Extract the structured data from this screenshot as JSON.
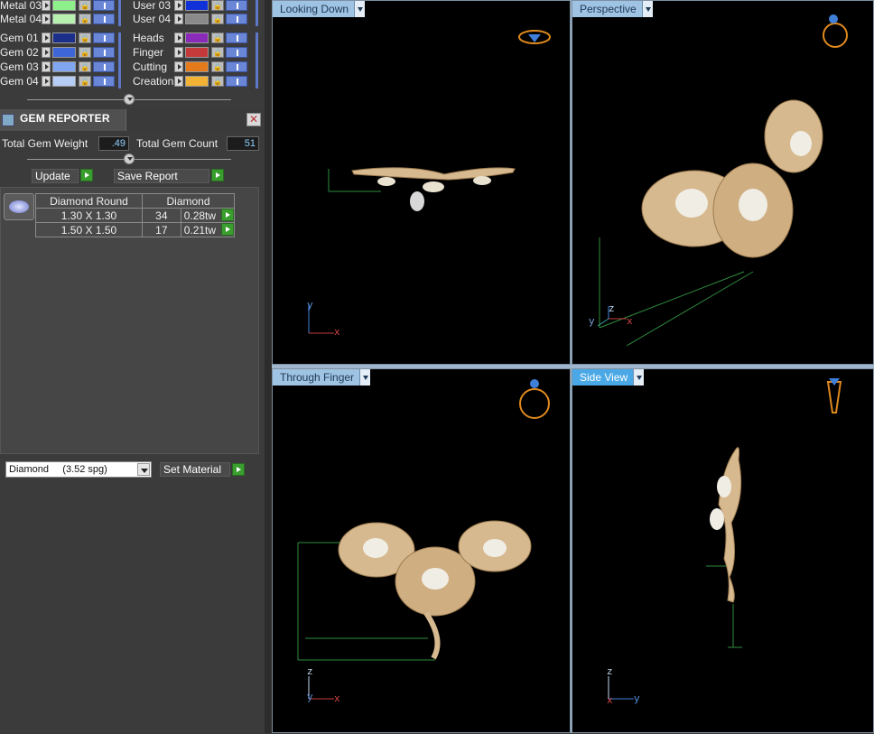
{
  "layers": {
    "left_column": [
      {
        "name": "Metal 03",
        "color": "#8ef08a"
      },
      {
        "name": "Metal 04",
        "color": "#b8f0b0"
      },
      {
        "name": "Gem 01",
        "color": "#1b2e8a"
      },
      {
        "name": "Gem 02",
        "color": "#3f66d6"
      },
      {
        "name": "Gem 03",
        "color": "#7fa6ef"
      },
      {
        "name": "Gem 04",
        "color": "#b5cdf5"
      }
    ],
    "right_column": [
      {
        "name": "User 03",
        "color": "#1030d8"
      },
      {
        "name": "User 04",
        "color": "#8a8a8a"
      },
      {
        "name": "Heads",
        "color": "#8a2ab8"
      },
      {
        "name": "Finger",
        "color": "#c43a3a"
      },
      {
        "name": "Cutting",
        "color": "#e57a1a"
      },
      {
        "name": "Creation",
        "color": "#f2b233"
      }
    ]
  },
  "gem_reporter": {
    "title": "GEM REPORTER",
    "close_label": "✕",
    "total_weight_label": "Total Gem Weight",
    "total_weight_value": ".49",
    "total_count_label": "Total Gem Count",
    "total_count_value": "51",
    "update_label": "Update",
    "save_report_label": "Save Report",
    "table": {
      "headers": [
        "Diamond Round",
        "Diamond"
      ],
      "rows": [
        {
          "size": "1.30 X 1.30",
          "count": "34",
          "weight": "0.28tw"
        },
        {
          "size": "1.50 X 1.50",
          "count": "17",
          "weight": "0.21tw"
        }
      ]
    },
    "material_select_value": "Diamond     (3.52 spg)",
    "set_material_label": "Set Material"
  },
  "viewports": [
    {
      "title": "Looking Down",
      "active": false,
      "axes": [
        "y",
        "x"
      ]
    },
    {
      "title": "Perspective",
      "active": false,
      "axes": [
        "y",
        "z",
        "x"
      ]
    },
    {
      "title": "Through Finger",
      "active": false,
      "axes": [
        "z",
        "y",
        "x"
      ]
    },
    {
      "title": "Side View",
      "active": true,
      "axes": [
        "z",
        "x",
        "y"
      ]
    }
  ],
  "colors": {
    "metal": "#d7b98f",
    "metal_dark": "#9c7b4f",
    "dimension_line": "#2e8b3e",
    "ring_icon": "#e08a1e",
    "gem_icon": "#3f7fd8"
  }
}
